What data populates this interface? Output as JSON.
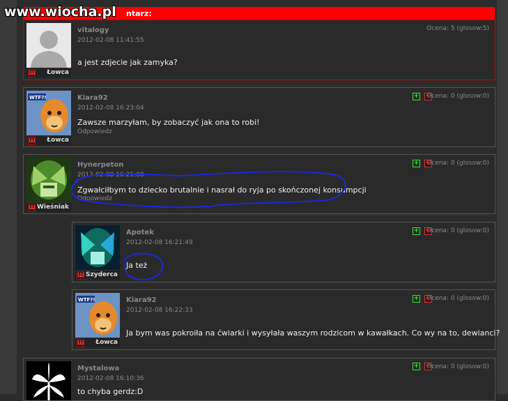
{
  "watermark": "www.wiocha.pl",
  "header": {
    "title_fragment": "ntarz:"
  },
  "comments": [
    {
      "author": "vitalogy",
      "date": "2012-02-08 11:41:55",
      "text": "a jest zdjecie jak zamyka?",
      "rank": "Łowca",
      "rating": "Ocena: 5 (glosow:5)",
      "reply": ""
    },
    {
      "author": "Kiara92",
      "date": "2012-02-08 16:23:04",
      "text": "Zawsze marzyłam, by zobaczyć jak ona to robi!",
      "rank": "Łowca",
      "rating": "Ocena: 0 (glosow:0)",
      "reply": "Odpowiedz"
    },
    {
      "author": "Hynerpeton",
      "date": "2012-02-08 16:21:08",
      "text": "Zgwałciłbym to dziecko brutalnie i nasrał do ryja po skończonej konsumpcji",
      "rank": "Wieśniak",
      "rating": "Ocena: 0 (glosow:0)",
      "reply": "Odpowiedz"
    },
    {
      "author": "Apotek",
      "date": "2012-02-08 16:21:49",
      "text": "Ja też",
      "rank": "Szyderca",
      "rating": "Ocena: 0 (glosow:0)",
      "reply": ""
    },
    {
      "author": "Kiara92",
      "date": "2012-02-08 16:22:33",
      "text": "Ja bym was pokroiła na ćwiarki i wysyłała waszym rodzicom w kawałkach. Co wy na to, dewianci?",
      "rank": "Łowca",
      "rating": "Ocena: 0 (glosow:0)",
      "reply": ""
    },
    {
      "author": "Mystalowa",
      "date": "2012-02-08 16:10:36",
      "text": "to chyba gerdz:D",
      "rank": "",
      "rating": "Ocena: 0 (glosow:0)",
      "reply": ""
    }
  ],
  "vote": {
    "plus": "+",
    "minus": "−"
  },
  "colors": {
    "header_red": "#ff0000",
    "scribble_blue": "#1a2bd6",
    "plus_green": "#4cd24c",
    "minus_red": "#e23030"
  }
}
